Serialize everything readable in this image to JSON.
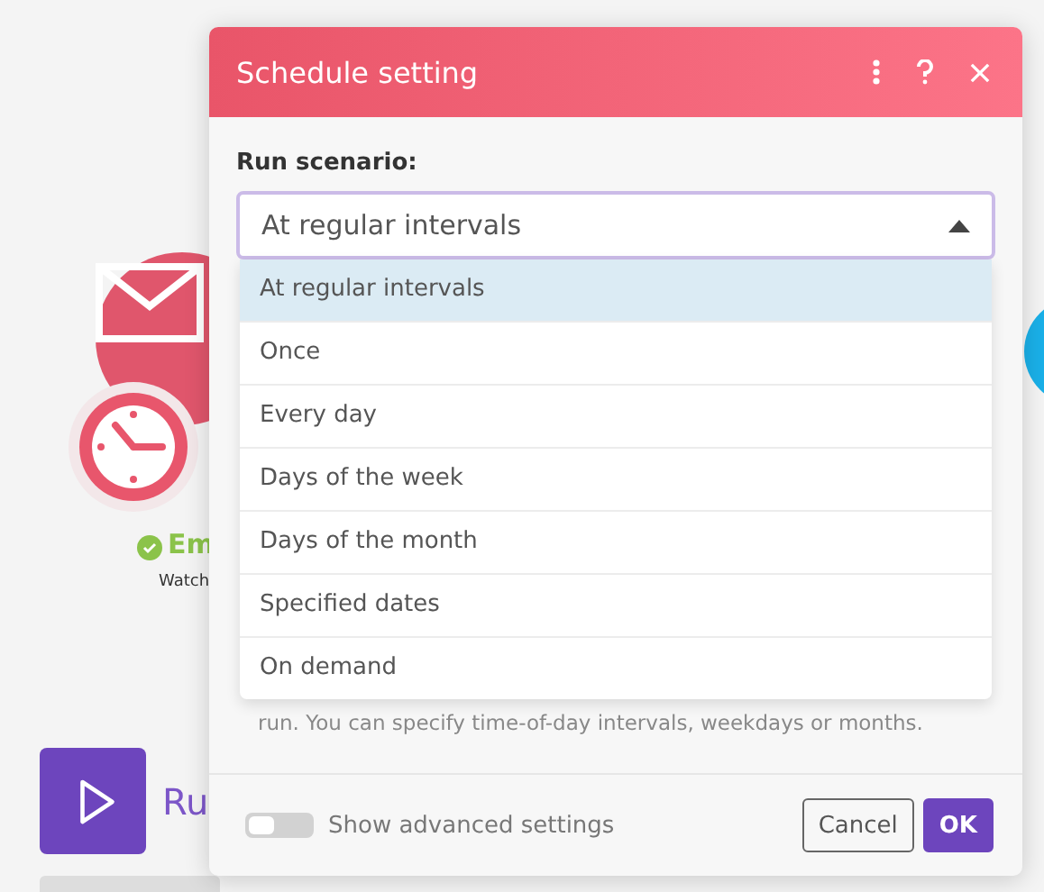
{
  "canvas": {
    "module_title": "Em",
    "module_subtitle": "Watch",
    "run_label": "Ru"
  },
  "dialog": {
    "title": "Schedule setting",
    "field_label": "Run scenario:",
    "select_value": "At regular intervals",
    "options": [
      {
        "label": "At regular intervals",
        "selected": true
      },
      {
        "label": "Once",
        "selected": false
      },
      {
        "label": "Every day",
        "selected": false
      },
      {
        "label": "Days of the week",
        "selected": false
      },
      {
        "label": "Days of the month",
        "selected": false
      },
      {
        "label": "Specified dates",
        "selected": false
      },
      {
        "label": "On demand",
        "selected": false
      }
    ],
    "hint": "run. You can specify time-of-day intervals, weekdays or months.",
    "advanced_settings": {
      "label": "Show advanced settings",
      "on": false
    },
    "buttons": [
      "Cancel",
      "OK"
    ]
  }
}
